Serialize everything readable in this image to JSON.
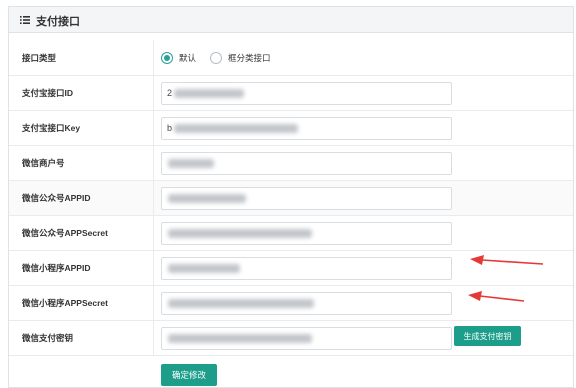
{
  "panel": {
    "title": "支付接口"
  },
  "fields": {
    "interface_type": {
      "label": "接口类型",
      "options": [
        "默认",
        "框分类接口"
      ],
      "selected": "默认"
    },
    "alipay_id": {
      "label": "支付宝接口ID",
      "value_prefix": "2"
    },
    "alipay_key": {
      "label": "支付宝接口Key",
      "value_prefix": "b"
    },
    "wechat_merchant": {
      "label": "微信商户号"
    },
    "wechat_appid": {
      "label": "微信公众号APPID"
    },
    "wechat_secret": {
      "label": "微信公众号APPSecret"
    },
    "mini_appid": {
      "label": "微信小程序APPID"
    },
    "mini_secret": {
      "label": "微信小程序APPSecret"
    },
    "pay_key": {
      "label": "微信支付密钥"
    }
  },
  "buttons": {
    "generate": "生成支付密钥",
    "save": "确定修改"
  },
  "colors": {
    "accent": "#1c9e8b",
    "annotation": "#e53935"
  },
  "icons": {
    "header": "list-icon"
  }
}
